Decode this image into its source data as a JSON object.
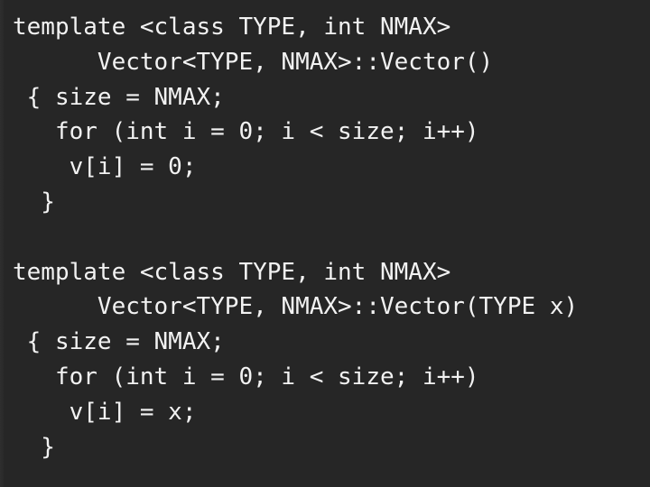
{
  "slide": {
    "kind": "code-slide",
    "language": "C++",
    "background_color": "#262626",
    "text_color": "#f2f2f2",
    "left_edge_band_color": "#2e2e2e"
  },
  "code": {
    "lines": [
      "template <class TYPE, int NMAX>",
      "      Vector<TYPE, NMAX>::Vector()",
      " { size = NMAX;",
      "   for (int i = 0; i < size; i++)",
      "    v[i] = 0;",
      "  }",
      "",
      "template <class TYPE, int NMAX>",
      "      Vector<TYPE, NMAX>::Vector(TYPE x)",
      " { size = NMAX;",
      "   for (int i = 0; i < size; i++)",
      "    v[i] = x;",
      "  }"
    ]
  }
}
